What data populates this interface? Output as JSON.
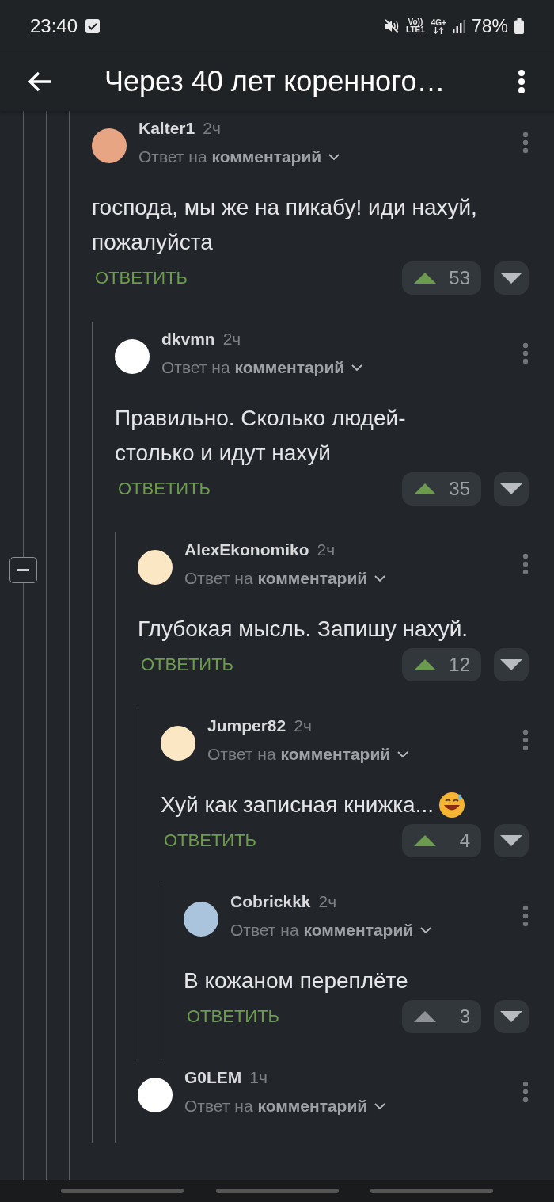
{
  "status_bar": {
    "time": "23:40",
    "volte": "Vo))",
    "lte": "LTE1",
    "network": "4G+",
    "battery": "78%"
  },
  "header": {
    "title": "Через 40 лет коренного…"
  },
  "comments": [
    {
      "author": "Kalter1",
      "time": "2ч",
      "reply_to": "Ответ на **комментарий**",
      "text": "господа, мы же на пикабу! иди нахуй, пожалуйста",
      "reply_button": "ОТВЕТИТЬ",
      "score": "53",
      "upvoted": true,
      "color": "#e8a584",
      "children": [
        {
          "author": "dkvmn",
          "time": "2ч",
          "reply_to": "Ответ на **комментарий**",
          "text": "Правильно. Сколько людей-столько и идут нахуй",
          "reply_button": "ОТВЕТИТЬ",
          "score": "35",
          "upvoted": true,
          "color": "#ffffff",
          "children": [
            {
              "author": "AlexEkonomiko",
              "time": "2ч",
              "reply_to": "Ответ на **комментарий**",
              "text": "Глубокая мысль. Запишу нахуй.",
              "reply_button": "ОТВЕТИТЬ",
              "score": "12",
              "upvoted": true,
              "color": "#fbe7c4",
              "children": [
                {
                  "author": "Jumper82",
                  "time": "2ч",
                  "reply_to": "Ответ на **комментарий**",
                  "text": "Хуй как записная книжка...",
                  "reply_button": "ОТВЕТИТЬ",
                  "score": "4",
                  "upvoted": true,
                  "color": "#fbe7c4",
                  "emoji": true,
                  "children": [
                    {
                      "author": "Cobrickkk",
                      "time": "2ч",
                      "reply_to": "Ответ на **комментарий**",
                      "text": "В кожаном переплёте",
                      "reply_button": "ОТВЕТИТЬ",
                      "score": "3",
                      "upvoted": false,
                      "color": "#a9c4dc"
                    }
                  ]
                }
              ]
            },
            {
              "author": "G0LEM",
              "time": "1ч",
              "reply_to": "Ответ на **комментарий**",
              "color": "#ffffff"
            }
          ]
        }
      ]
    }
  ]
}
